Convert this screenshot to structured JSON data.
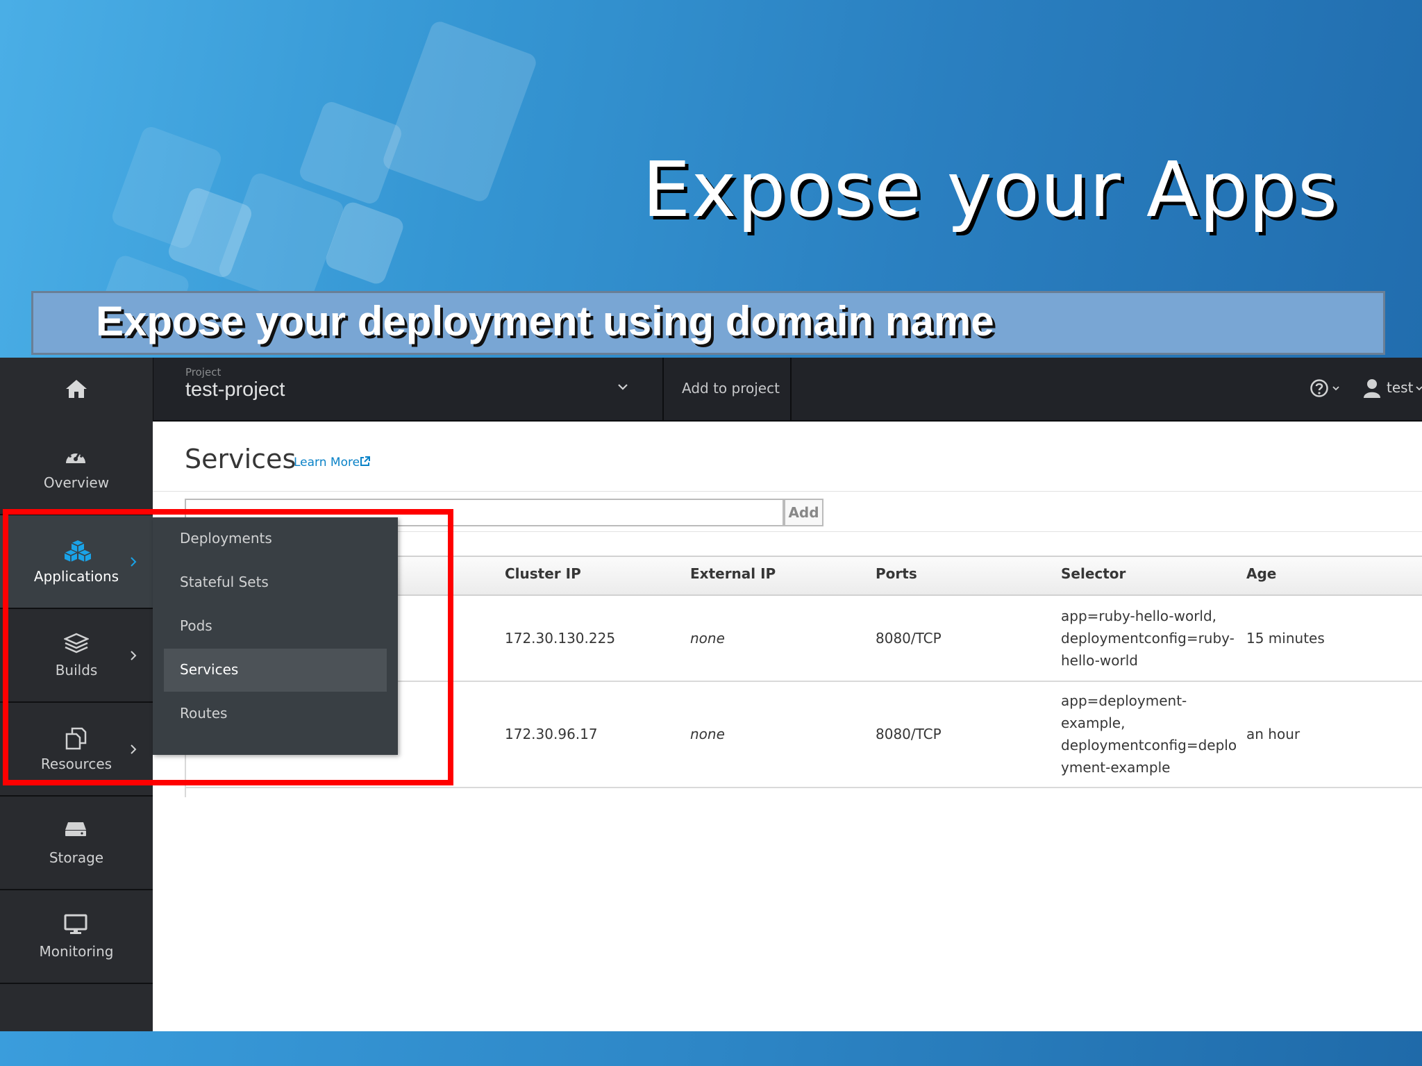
{
  "slide": {
    "title": "Expose your Apps",
    "subtitle": "Expose your deployment using domain name"
  },
  "topbar": {
    "project_label": "Project",
    "project_name": "test-project",
    "add_to_project": "Add to project",
    "user_name": "test"
  },
  "sidebar": {
    "items": [
      {
        "label": "Overview",
        "icon": "dashboard-icon"
      },
      {
        "label": "Applications",
        "icon": "cubes-icon",
        "active": true
      },
      {
        "label": "Builds",
        "icon": "layers-icon"
      },
      {
        "label": "Resources",
        "icon": "copy-icon"
      },
      {
        "label": "Storage",
        "icon": "storage-icon"
      },
      {
        "label": "Monitoring",
        "icon": "monitor-icon"
      }
    ]
  },
  "flyout": {
    "items": [
      {
        "label": "Deployments"
      },
      {
        "label": "Stateful Sets"
      },
      {
        "label": "Pods"
      },
      {
        "label": "Services",
        "active": true
      },
      {
        "label": "Routes"
      }
    ]
  },
  "page": {
    "title": "Services",
    "learn_more": "Learn More",
    "add_button": "Add"
  },
  "table": {
    "columns": [
      "Cluster IP",
      "External IP",
      "Ports",
      "Selector",
      "Age"
    ],
    "rows": [
      {
        "cluster_ip": "172.30.130.225",
        "external_ip": "none",
        "ports": "8080/TCP",
        "selector_lines": [
          "app=ruby-hello-world,",
          "deploymentconfig=ruby-",
          "hello-world"
        ],
        "age": "15 minutes"
      },
      {
        "cluster_ip": "172.30.96.17",
        "external_ip": "none",
        "ports": "8080/TCP",
        "selector_lines": [
          "app=deployment-",
          "example,",
          "deploymentconfig=deplo",
          "yment-example"
        ],
        "age": "an hour"
      }
    ]
  },
  "colors": {
    "highlight": "#ff0000",
    "link": "#0a82c7",
    "active_icon": "#1aa3e8"
  }
}
